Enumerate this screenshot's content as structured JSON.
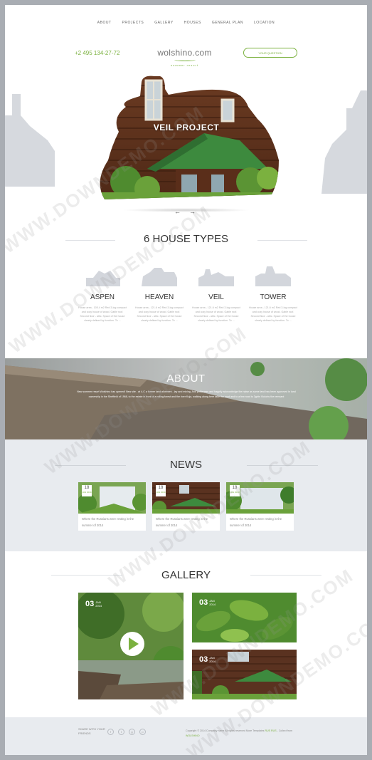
{
  "nav": [
    "ABOUT",
    "PROJECTS",
    "GALLERY",
    "HOUSES",
    "GENERAL PLAN",
    "LOCATION"
  ],
  "header": {
    "phone": "+2 495 134-27-72",
    "logo": "wolshino.com",
    "tagline": "summer resort",
    "question_button": "YOUR QUESTION"
  },
  "hero": {
    "title": "VEIL PROJECT",
    "prev_arrow": "←",
    "next_arrow": "→"
  },
  "house_types": {
    "title": "6 HOUSE TYPES",
    "items": [
      {
        "name": "ASPEN",
        "desc": "House area - 105.4 m2 Red 3-log compact and cozy house of wood. Gable roof. Second floor - attic. Space of the house clearly defined by function. To ..."
      },
      {
        "name": "HEAVEN",
        "desc": "House area - 121.6 m2 Red 3-log compact and cozy house of wood. Gable roof. Second floor - attic. Space of the house clearly defined by function. To ..."
      },
      {
        "name": "VEIL",
        "desc": "House area - 121.6 m2 Red 3-log compact and cozy house of wood. Gable roof. Second floor - attic. Space of the house clearly defined by function. To ..."
      },
      {
        "name": "TOWER",
        "desc": "House area - 121.6 m2 Red 3-log compact and cozy house of wood. Gable roof. Second floor - attic. Space of the house clearly defined by function. To ..."
      }
    ]
  },
  "about": {
    "title": "ABOUT",
    "text": "New summer resort Wolshino has opened! New site - at 4-C a former land allotment - lay and mixing. And politeness and happily acknowledge the noise as some land has been approved in land ownership in the Sheffield of 1968, to the estate in front of a rolling forest and the river Kuja, walking along here take the road and to a few road to 3gbtn Vickchs the remnant"
  },
  "news": {
    "title": "NEWS",
    "items": [
      {
        "day": "18",
        "month": "JAN 2014",
        "text": "Where the Russians were resting in the summer of 2014"
      },
      {
        "day": "18",
        "month": "JAN 2014",
        "text": "Where the Russians were resting in the summer of 2014"
      },
      {
        "day": "18",
        "month": "JAN 2014",
        "text": "Where the Russians were resting in the summer of 2014"
      }
    ]
  },
  "gallery": {
    "title": "GALLERY",
    "items": [
      {
        "day": "03",
        "month": "JAN",
        "year": "2014"
      },
      {
        "day": "03",
        "month": "JAN",
        "year": "2014"
      },
      {
        "day": "03",
        "month": "JAN",
        "year": "2014"
      }
    ]
  },
  "footer": {
    "share": "SHARE WITH YOUR FRIENDS",
    "social": [
      "f",
      "t",
      "g",
      "p"
    ],
    "copyright": "Copyright © 2014 Company name All rights reserved More Templates",
    "link1": "RUS",
    "link2": "RUS",
    "collect": "- Collect from",
    "link3": "WOLSHINO"
  },
  "watermark": "WWW.DOWNDEMO.COM",
  "colors": {
    "accent": "#7bb13f",
    "light_bg": "#e8ebef",
    "frame": "#a9adb3"
  }
}
